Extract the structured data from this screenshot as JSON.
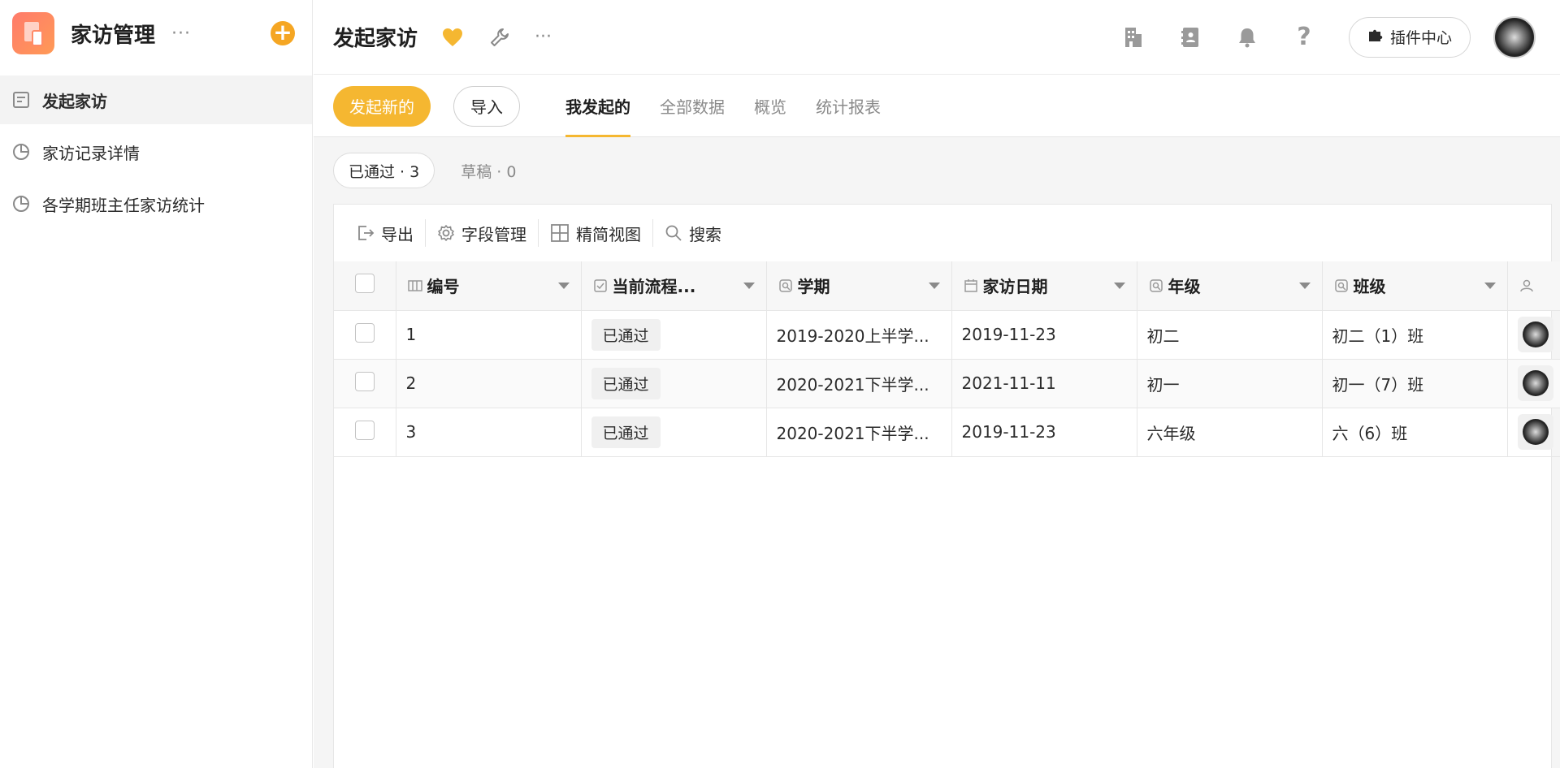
{
  "sidebar": {
    "app_title": "家访管理",
    "more": "···",
    "add": "+",
    "items": [
      {
        "label": "发起家访",
        "icon": "form-icon"
      },
      {
        "label": "家访记录详情",
        "icon": "pie-chart-icon"
      },
      {
        "label": "各学期班主任家访统计",
        "icon": "pie-chart-icon"
      }
    ]
  },
  "header": {
    "title": "发起家访",
    "more": "···",
    "plugin_label": "插件中心",
    "icons": [
      "heart-icon",
      "wrench-icon",
      "more-icon",
      "building-icon",
      "contacts-icon",
      "bell-icon",
      "help-icon",
      "puzzle-icon"
    ]
  },
  "actions": {
    "primary": "发起新的",
    "import": "导入"
  },
  "tabs": [
    "我发起的",
    "全部数据",
    "概览",
    "统计报表"
  ],
  "filters": {
    "approved": "已通过 · 3",
    "draft": "草稿 · 0"
  },
  "toolbar": {
    "export": "导出",
    "fields": "字段管理",
    "compact": "精简视图",
    "search": "搜索"
  },
  "table": {
    "columns": [
      "编号",
      "当前流程...",
      "学期",
      "家访日期",
      "年级",
      "班级"
    ],
    "rows": [
      {
        "id": "1",
        "status": "已通过",
        "term": "2019-2020上半学...",
        "date": "2019-11-23",
        "grade": "初二",
        "class": "初二（1）班"
      },
      {
        "id": "2",
        "status": "已通过",
        "term": "2020-2021下半学...",
        "date": "2021-11-11",
        "grade": "初一",
        "class": "初一（7）班"
      },
      {
        "id": "3",
        "status": "已通过",
        "term": "2020-2021下半学...",
        "date": "2019-11-23",
        "grade": "六年级",
        "class": "六（6）班"
      }
    ]
  },
  "colors": {
    "accent": "#f5b731",
    "add_button": "#f5a623",
    "logo": "#ff8a67"
  }
}
